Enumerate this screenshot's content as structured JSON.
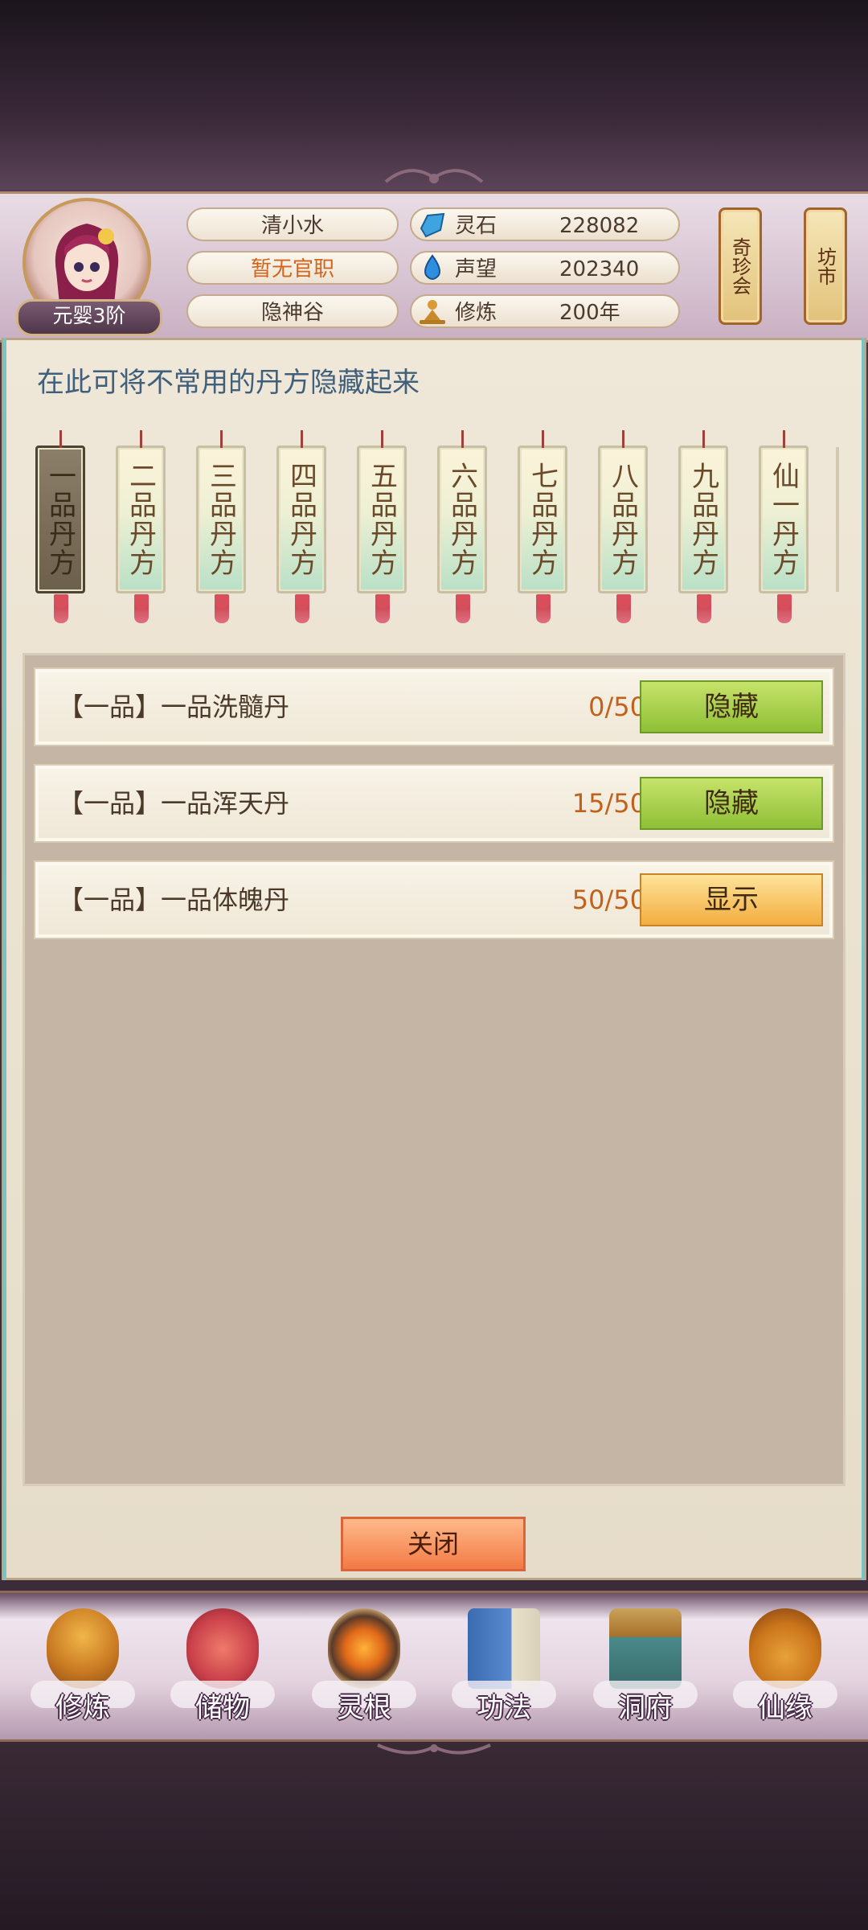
{
  "player": {
    "name": "清小水",
    "official_title": "暂无官职",
    "sect": "隐神谷",
    "realm": "元婴3阶"
  },
  "resources": [
    {
      "label": "灵石",
      "value": "228082",
      "icon": "spirit-stone-icon"
    },
    {
      "label": "声望",
      "value": "202340",
      "icon": "prestige-drop-icon"
    },
    {
      "label": "修炼",
      "value": "200年",
      "icon": "meditation-icon"
    }
  ],
  "side_buttons": {
    "treasure": "奇珍会",
    "market": "坊市"
  },
  "panel": {
    "hint": "在此可将不常用的丹方隐藏起来"
  },
  "tabs": [
    {
      "label": "一品丹方",
      "selected": true
    },
    {
      "label": "二品丹方",
      "selected": false
    },
    {
      "label": "三品丹方",
      "selected": false
    },
    {
      "label": "四品丹方",
      "selected": false
    },
    {
      "label": "五品丹方",
      "selected": false
    },
    {
      "label": "六品丹方",
      "selected": false
    },
    {
      "label": "七品丹方",
      "selected": false
    },
    {
      "label": "八品丹方",
      "selected": false
    },
    {
      "label": "九品丹方",
      "selected": false
    },
    {
      "label": "仙一丹方",
      "selected": false
    }
  ],
  "recipes": [
    {
      "name": "【一品】一品洗髓丹",
      "count": "0/50",
      "action": "隐藏"
    },
    {
      "name": "【一品】一品浑天丹",
      "count": "15/50",
      "action": "隐藏"
    },
    {
      "name": "【一品】一品体魄丹",
      "count": "50/50",
      "action": "显示"
    }
  ],
  "close_label": "关闭",
  "nav": [
    {
      "label": "修炼",
      "icon": "cultivation-monk-icon"
    },
    {
      "label": "储物",
      "icon": "storage-bag-icon"
    },
    {
      "label": "灵根",
      "icon": "spirit-root-icon"
    },
    {
      "label": "功法",
      "icon": "technique-book-icon"
    },
    {
      "label": "洞府",
      "icon": "cave-dwelling-icon"
    },
    {
      "label": "仙缘",
      "icon": "immortal-fate-gourd-icon"
    }
  ],
  "colors": {
    "hide_button": "#a6d04a",
    "show_button": "#f6c25a",
    "close_button": "#f58a55",
    "hint_text": "#3f5f7a",
    "count_text": "#c1621c"
  }
}
